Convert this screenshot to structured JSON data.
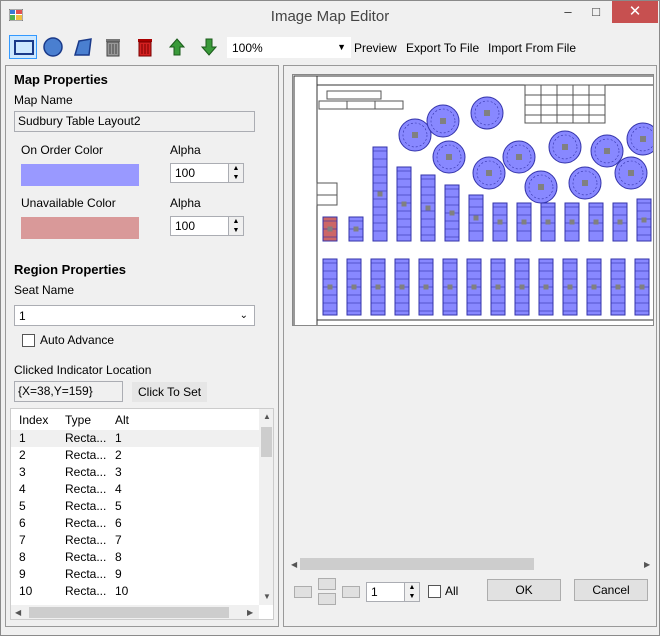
{
  "window": {
    "title": "Image Map Editor",
    "min_glyph": "–",
    "max_glyph": "□",
    "close_glyph": "✕"
  },
  "toolbar": {
    "zoom_value": "100%",
    "zoom_arrow": "▼",
    "preview_label": "Preview",
    "export_label": "Export To File",
    "import_label": "Import From File"
  },
  "map_properties": {
    "header": "Map Properties",
    "map_name_label": "Map Name",
    "map_name_value": "Sudbury Table Layout2",
    "on_order_label": "On Order Color",
    "on_order_color": "#9999ff",
    "on_order_alpha_label": "Alpha",
    "on_order_alpha": "100",
    "unavailable_label": "Unavailable Color",
    "unavailable_color": "#d99999",
    "unavailable_alpha_label": "Alpha",
    "unavailable_alpha": "100"
  },
  "region_properties": {
    "header": "Region Properties",
    "seat_name_label": "Seat Name",
    "seat_name_value": "1",
    "auto_advance_label": "Auto Advance",
    "clicked_indicator_label": "Clicked Indicator Location",
    "clicked_indicator_value": "{X=38,Y=159}",
    "click_to_set_label": "Click To Set"
  },
  "regions_grid": {
    "columns": [
      "Index",
      "Type",
      "Alt"
    ],
    "rows": [
      {
        "index": "1",
        "type": "Recta...",
        "alt": "1"
      },
      {
        "index": "2",
        "type": "Recta...",
        "alt": "2"
      },
      {
        "index": "3",
        "type": "Recta...",
        "alt": "3"
      },
      {
        "index": "4",
        "type": "Recta...",
        "alt": "4"
      },
      {
        "index": "5",
        "type": "Recta...",
        "alt": "5"
      },
      {
        "index": "6",
        "type": "Recta...",
        "alt": "6"
      },
      {
        "index": "7",
        "type": "Recta...",
        "alt": "7"
      },
      {
        "index": "8",
        "type": "Recta...",
        "alt": "8"
      },
      {
        "index": "9",
        "type": "Recta...",
        "alt": "9"
      },
      {
        "index": "10",
        "type": "Recta...",
        "alt": "10"
      }
    ]
  },
  "footer": {
    "page_value": "1",
    "all_label": "All",
    "ok_label": "OK",
    "cancel_label": "Cancel"
  },
  "map_colors": {
    "region_fill": "#8888ff",
    "region_stroke": "#3333aa",
    "selected_fill": "#cc6666",
    "seat_marker": "#808080"
  }
}
